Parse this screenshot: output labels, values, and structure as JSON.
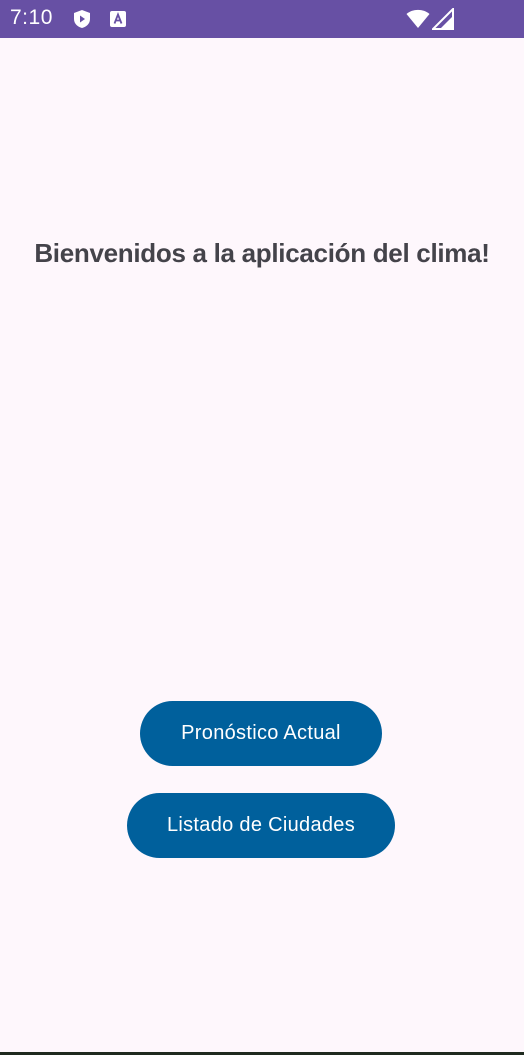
{
  "status_bar": {
    "time": "7:10",
    "icons": [
      "shield-play-icon",
      "a-badge-icon",
      "wifi-icon",
      "signal-icon"
    ],
    "background_color": "#6750a4"
  },
  "main": {
    "title": "Bienvenidos a la aplicación del clima!",
    "background_color": "#fef7fc",
    "buttons": [
      {
        "label": "Pronóstico Actual"
      },
      {
        "label": "Listado de Ciudades"
      }
    ],
    "button_color": "#00609c"
  }
}
